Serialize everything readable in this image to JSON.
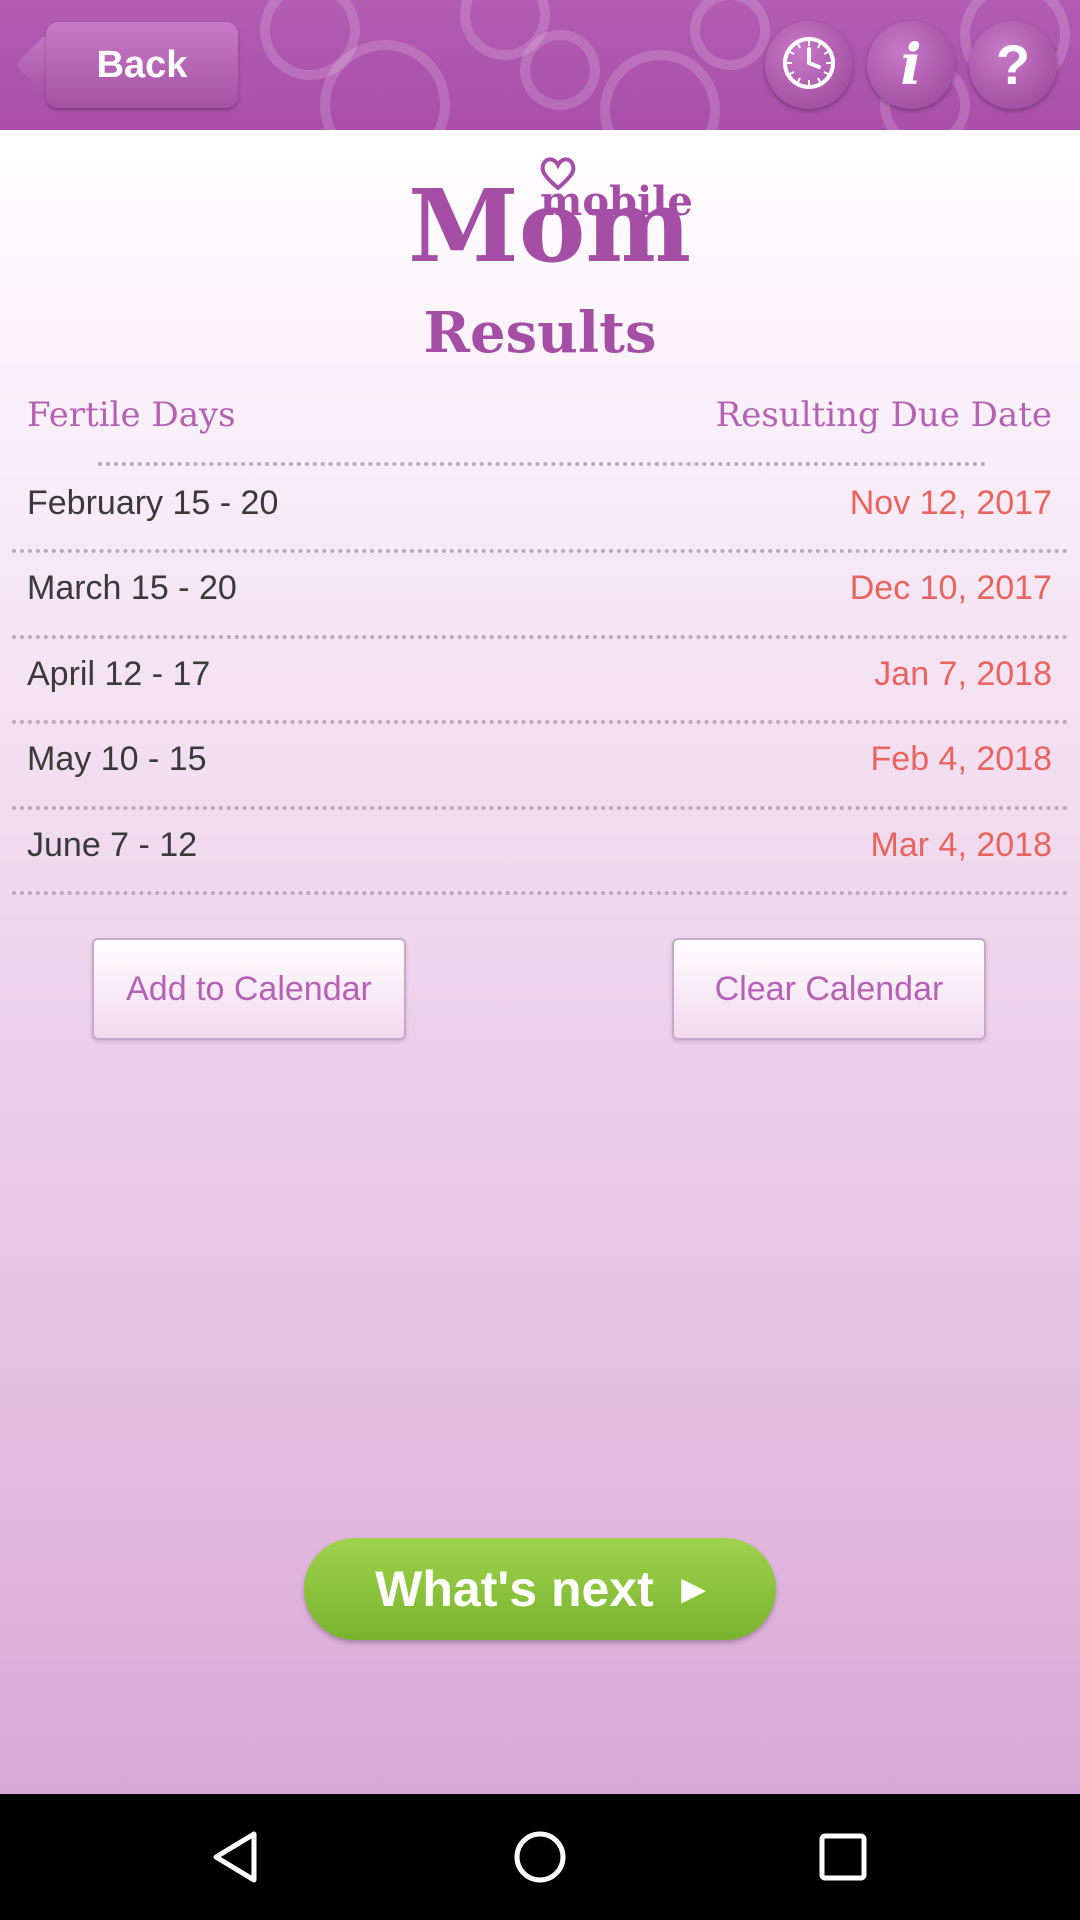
{
  "header": {
    "back_label": "Back",
    "icons": [
      "clock-icon",
      "info-icon",
      "help-icon"
    ],
    "info_glyph": "i",
    "help_glyph": "?"
  },
  "logo": {
    "small": "mobile",
    "large": "Mom"
  },
  "page_title": "Results",
  "table": {
    "headers": {
      "fertile": "Fertile Days",
      "due": "Resulting Due Date"
    },
    "rows": [
      {
        "fertile": "February 15 - 20",
        "due": "Nov 12, 2017"
      },
      {
        "fertile": "March 15 - 20",
        "due": "Dec 10, 2017"
      },
      {
        "fertile": "April 12 - 17",
        "due": "Jan 7, 2018"
      },
      {
        "fertile": "May 10 - 15",
        "due": "Feb 4, 2018"
      },
      {
        "fertile": "June 7 - 12",
        "due": "Mar 4, 2018"
      }
    ]
  },
  "buttons": {
    "add_calendar": "Add to Calendar",
    "clear_calendar": "Clear Calendar",
    "whats_next": "What's next",
    "whats_next_arrow": "▶"
  },
  "colors": {
    "brand_purple": "#a54ea6",
    "due_date_red": "#e8645f",
    "next_green": "#8cc53f"
  }
}
